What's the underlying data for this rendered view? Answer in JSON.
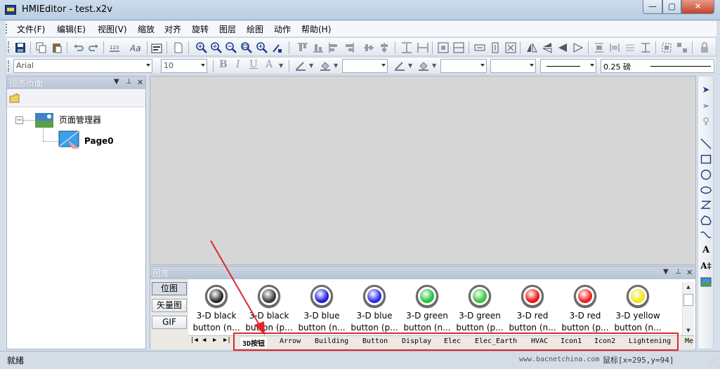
{
  "window": {
    "title": "HMIEditor - test.x2v",
    "min": "—",
    "max": "▢",
    "close": "✕"
  },
  "menu": [
    "文件(F)",
    "编辑(E)",
    "视图(V)",
    "缩放",
    "对齐",
    "旋转",
    "图层",
    "绘图",
    "动作",
    "帮助(H)"
  ],
  "format_bar": {
    "font": "Arial",
    "size": "10",
    "line_width": "0.25 磅"
  },
  "left_panel": {
    "title": "组态页面",
    "tree_root": "页面管理器",
    "tree_child": "Page0"
  },
  "gallery": {
    "title": "图库",
    "categories": [
      "位图",
      "矢量图",
      "GIF"
    ],
    "items": [
      {
        "line1": "3-D black",
        "line2": "button (n...",
        "color": "#2a2a2a"
      },
      {
        "line1": "3-D black",
        "line2": "button (p...",
        "color": "#3a3a3a"
      },
      {
        "line1": "3-D blue",
        "line2": "button (n...",
        "color": "#1f1fe0"
      },
      {
        "line1": "3-D blue",
        "line2": "button (p...",
        "color": "#2a2ae8"
      },
      {
        "line1": "3-D green",
        "line2": "button (n...",
        "color": "#22c33a"
      },
      {
        "line1": "3-D green",
        "line2": "button (p...",
        "color": "#39c43a"
      },
      {
        "line1": "3-D red",
        "line2": "button (n...",
        "color": "#ee1212"
      },
      {
        "line1": "3-D red",
        "line2": "button (p...",
        "color": "#ef1d1d"
      },
      {
        "line1": "3-D yellow",
        "line2": "button (n...",
        "color": "#f2e618"
      }
    ],
    "tabs": [
      "3D按钮",
      "Arrow",
      "Building",
      "Button",
      "Display",
      "Elec",
      "Elec_Earth",
      "HVAC",
      "Icon1",
      "Icon2",
      "Lightening",
      "Me"
    ]
  },
  "status": {
    "left": "就绪",
    "site": "www.bacnetchina.com",
    "mouse": "鼠标[x=295,y=94]"
  },
  "colors": {
    "highlight_box": "#e0262b",
    "canvas": "#d6d6d6"
  }
}
